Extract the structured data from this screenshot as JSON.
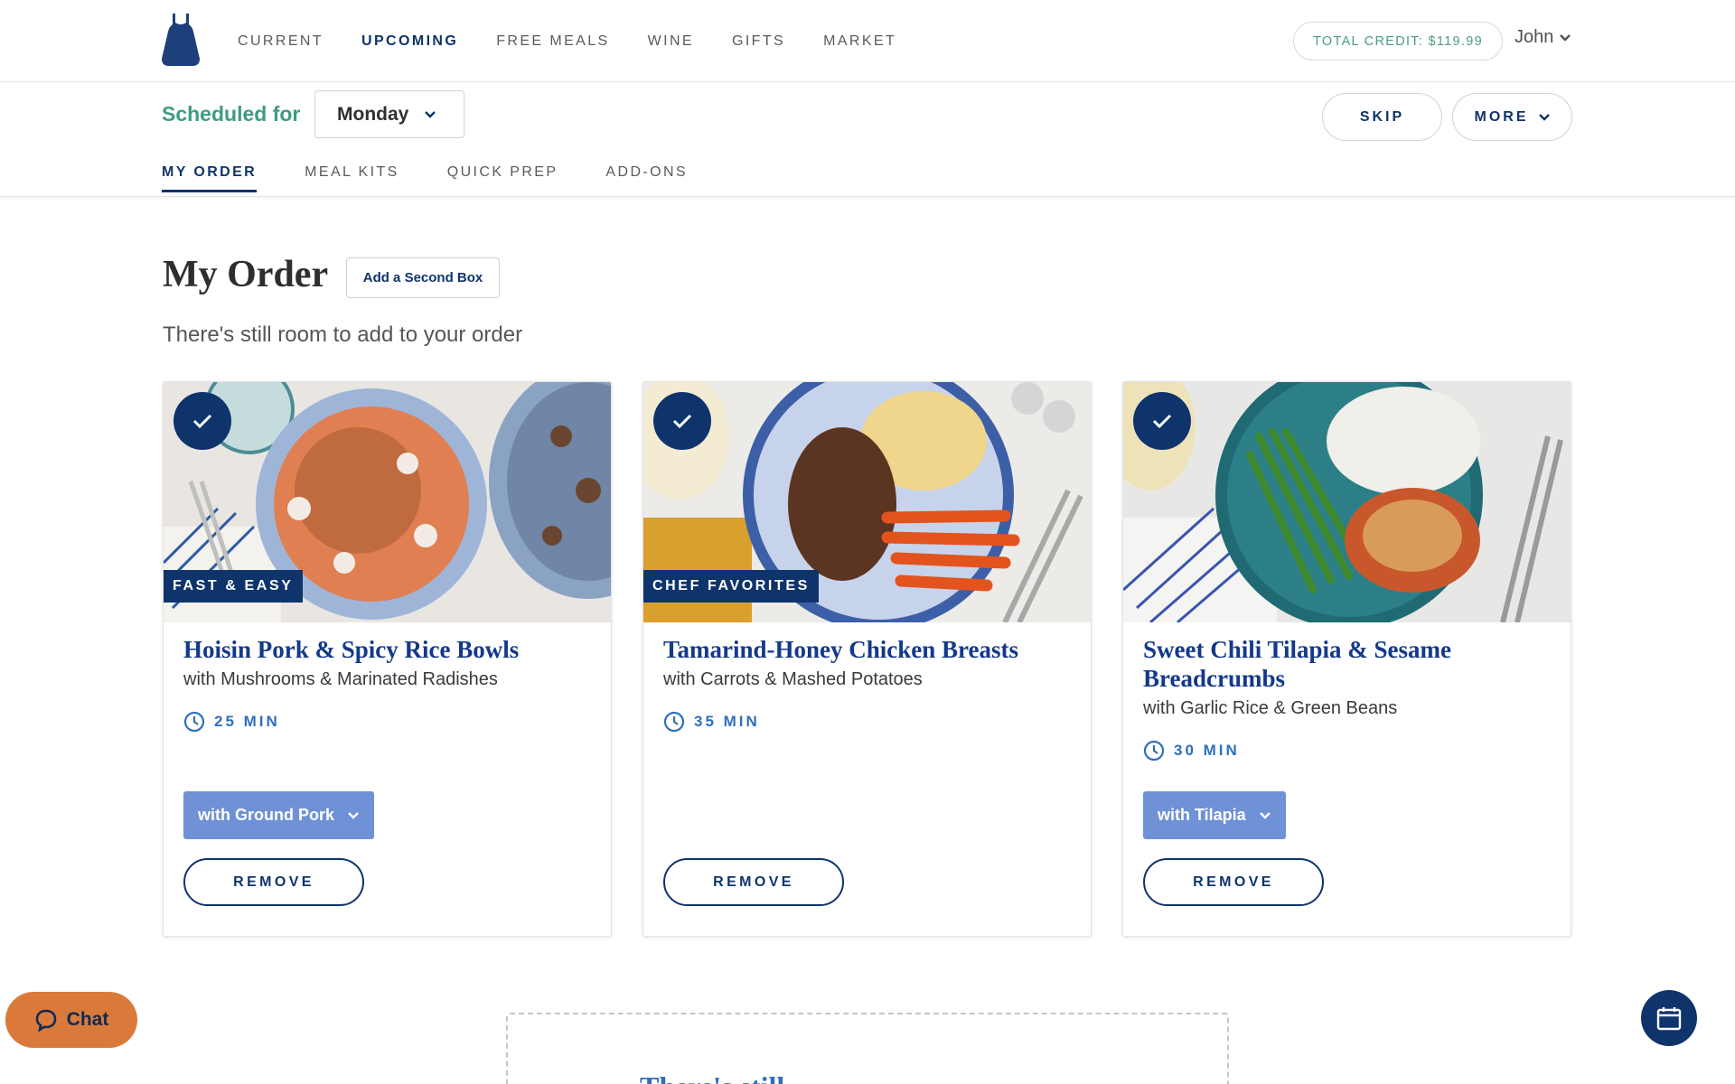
{
  "nav": {
    "links": [
      "CURRENT",
      "UPCOMING",
      "FREE MEALS",
      "WINE",
      "GIFTS",
      "MARKET"
    ],
    "active": "UPCOMING",
    "credit": "TOTAL CREDIT: $119.99",
    "user": "John"
  },
  "schedule": {
    "label": "Scheduled for",
    "day": "Monday",
    "skip": "SKIP",
    "more": "MORE"
  },
  "subtabs": [
    "MY ORDER",
    "MEAL KITS",
    "QUICK PREP",
    "ADD-ONS"
  ],
  "main": {
    "title": "My Order",
    "second_box": "Add a Second Box",
    "subtitle": "There's still room to add to your order",
    "remove_label": "REMOVE"
  },
  "meals": [
    {
      "tag": "FAST & EASY",
      "title": "Hoisin Pork & Spicy Rice Bowls",
      "subtitle": "with Mushrooms & Marinated Radishes",
      "time": "25 MIN",
      "variant": "with Ground Pork"
    },
    {
      "tag": "CHEF FAVORITES",
      "title": "Tamarind-Honey Chicken Breasts",
      "subtitle": "with Carrots & Mashed Potatoes",
      "time": "35 MIN",
      "variant": ""
    },
    {
      "tag": "",
      "title": "Sweet Chili Tilapia & Sesame Breadcrumbs",
      "subtitle": "with Garlic Rice & Green Beans",
      "time": "30 MIN",
      "variant": "with Tilapia"
    }
  ],
  "chat": "Chat",
  "bottom_partial_text": "There's still",
  "icons": {
    "logo": "apron-logo-icon",
    "check": "checkmark-icon",
    "clock": "clock-icon",
    "chat": "chat-bubble-icon",
    "calendar": "calendar-icon"
  },
  "colors": {
    "brand_navy": "#0f346c",
    "accent_green": "#3d9c82",
    "link_blue": "#2f6fbd",
    "variant_blue": "#6f91d5",
    "chat_orange": "#d97a3a"
  }
}
